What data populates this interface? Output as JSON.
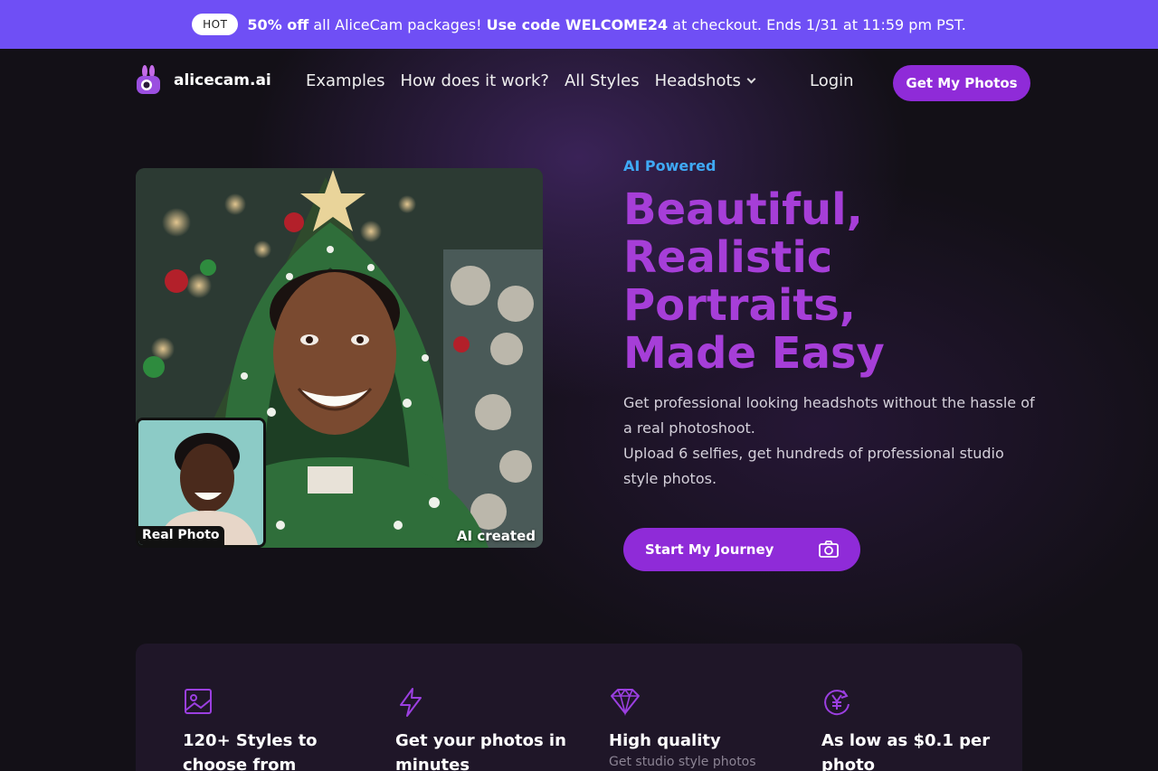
{
  "promo": {
    "badge": "HOT",
    "highlight": "50% off",
    "text1": "all AliceCam packages!",
    "code_label": "Use code WELCOME24",
    "text2": "at checkout. Ends 1/31 at 11:59 pm PST."
  },
  "nav": {
    "brand": "alicecam.ai",
    "links": [
      "Examples",
      "How does it work?",
      "All Styles",
      "Headshots"
    ],
    "login": "Login",
    "cta": "Get My Photos"
  },
  "hero": {
    "eyebrow": "AI Powered",
    "headline": [
      "Beautiful,",
      "Realistic",
      "Portraits,",
      "Made Easy"
    ],
    "sub1": "Get professional looking headshots without the hassle of a real photoshoot.",
    "sub2": "Upload 6 selfies, get hundreds of professional studio style photos.",
    "button": "Start My Journey",
    "ai_label": "AI created",
    "real_label": "Real Photo"
  },
  "features": [
    {
      "icon": "image-icon",
      "title": "120+ Styles to choose from",
      "desc": ""
    },
    {
      "icon": "lightning-icon",
      "title": "Get your photos in minutes",
      "desc": ""
    },
    {
      "icon": "diamond-icon",
      "title": "High quality",
      "desc": "Get studio style photos"
    },
    {
      "icon": "yen-cycle-icon",
      "title": "As low as $0.1 per photo",
      "desc": ""
    }
  ],
  "colors": {
    "banner": "#6f4ff5",
    "accent_purple": "#8f2bd8",
    "headline": "#a63ed8",
    "eyebrow_blue": "#3fa9f5"
  }
}
